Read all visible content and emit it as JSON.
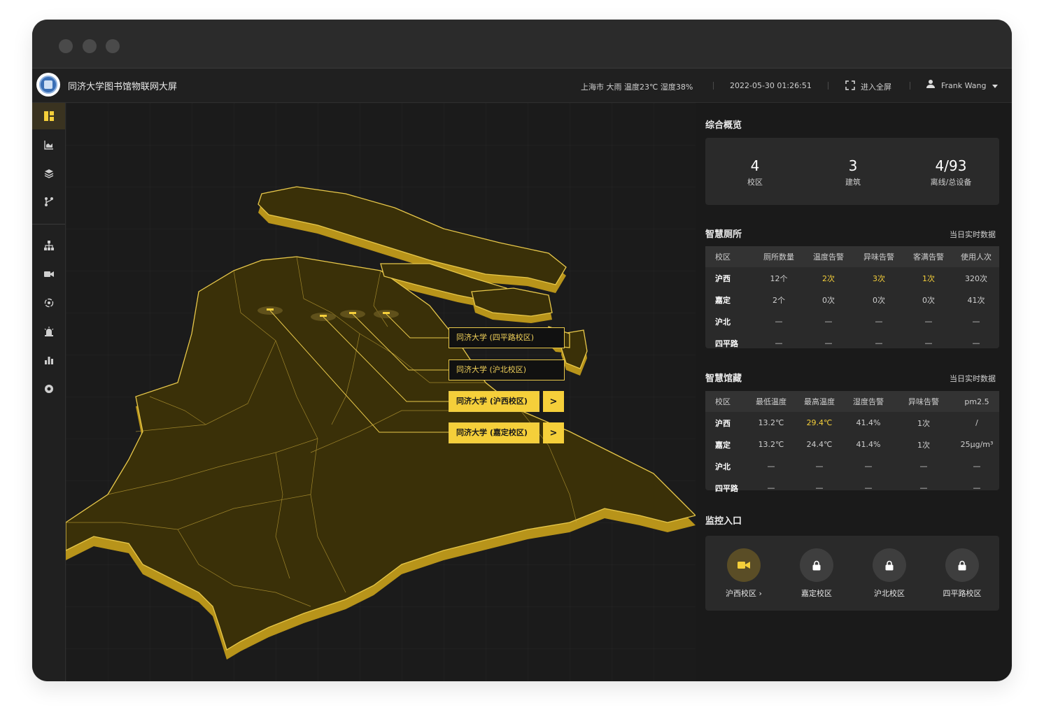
{
  "app": {
    "title": "同济大学图书馆物联网大屏"
  },
  "topbar": {
    "weather": "上海市 大雨 温度23℃ 湿度38%",
    "datetime": "2022-05-30 01:26:51",
    "fullscreen_label": "进入全屏",
    "user_name": "Frank Wang"
  },
  "sidebar": {
    "items": [
      {
        "icon": "dashboard-icon",
        "active": true
      },
      {
        "icon": "area-chart-icon"
      },
      {
        "icon": "layers-icon"
      },
      {
        "icon": "branch-icon"
      },
      {
        "icon": "org-tree-icon"
      },
      {
        "icon": "video-camera-icon"
      },
      {
        "icon": "recycle-icon"
      },
      {
        "icon": "alarm-icon"
      },
      {
        "icon": "bar-chart-icon"
      },
      {
        "icon": "settings-icon"
      }
    ]
  },
  "map": {
    "campuses": [
      {
        "label": "同济大学 (四平路校区)",
        "highlighted": false
      },
      {
        "label": "同济大学 (沪北校区)",
        "highlighted": false
      },
      {
        "label": "同济大学 (沪西校区)",
        "highlighted": true
      },
      {
        "label": "同济大学 (嘉定校区)",
        "highlighted": true
      }
    ],
    "arrow": ">"
  },
  "overview": {
    "title": "综合概览",
    "stats": [
      {
        "value": "4",
        "label": "校区"
      },
      {
        "value": "3",
        "label": "建筑"
      },
      {
        "value": "4/93",
        "label": "离线/总设备"
      }
    ]
  },
  "toilet": {
    "title": "智慧厕所",
    "subtitle": "当日实时数据",
    "columns": [
      "校区",
      "厕所数量",
      "温度告警",
      "异味告警",
      "客满告警",
      "使用人次"
    ],
    "rows": [
      [
        "沪西",
        "12个",
        "2次",
        "3次",
        "1次",
        "320次"
      ],
      [
        "嘉定",
        "2个",
        "0次",
        "0次",
        "0次",
        "41次"
      ],
      [
        "沪北",
        "—",
        "—",
        "—",
        "—",
        "—"
      ],
      [
        "四平路",
        "—",
        "—",
        "—",
        "—",
        "—"
      ]
    ]
  },
  "collection": {
    "title": "智慧馆藏",
    "subtitle": "当日实时数据",
    "columns": [
      "校区",
      "最低温度",
      "最高温度",
      "湿度告警",
      "异味告警",
      "pm2.5"
    ],
    "rows": [
      [
        "沪西",
        "13.2℃",
        "29.4℃",
        "41.4%",
        "1次",
        "/"
      ],
      [
        "嘉定",
        "13.2℃",
        "24.4℃",
        "41.4%",
        "1次",
        "25μg/m³"
      ],
      [
        "沪北",
        "—",
        "—",
        "—",
        "—",
        "—"
      ],
      [
        "四平路",
        "—",
        "—",
        "—",
        "—",
        "—"
      ]
    ]
  },
  "monitor": {
    "title": "监控入口",
    "items": [
      {
        "label": "沪西校区 ›",
        "icon": "video-camera-icon",
        "active": true
      },
      {
        "label": "嘉定校区",
        "icon": "lock-icon",
        "active": false
      },
      {
        "label": "沪北校区",
        "icon": "lock-icon",
        "active": false
      },
      {
        "label": "四平路校区",
        "icon": "lock-icon",
        "active": false
      }
    ]
  },
  "colors": {
    "accent": "#f5cf3a",
    "map_fill": "#3a3008",
    "map_side": "#b8941a"
  }
}
